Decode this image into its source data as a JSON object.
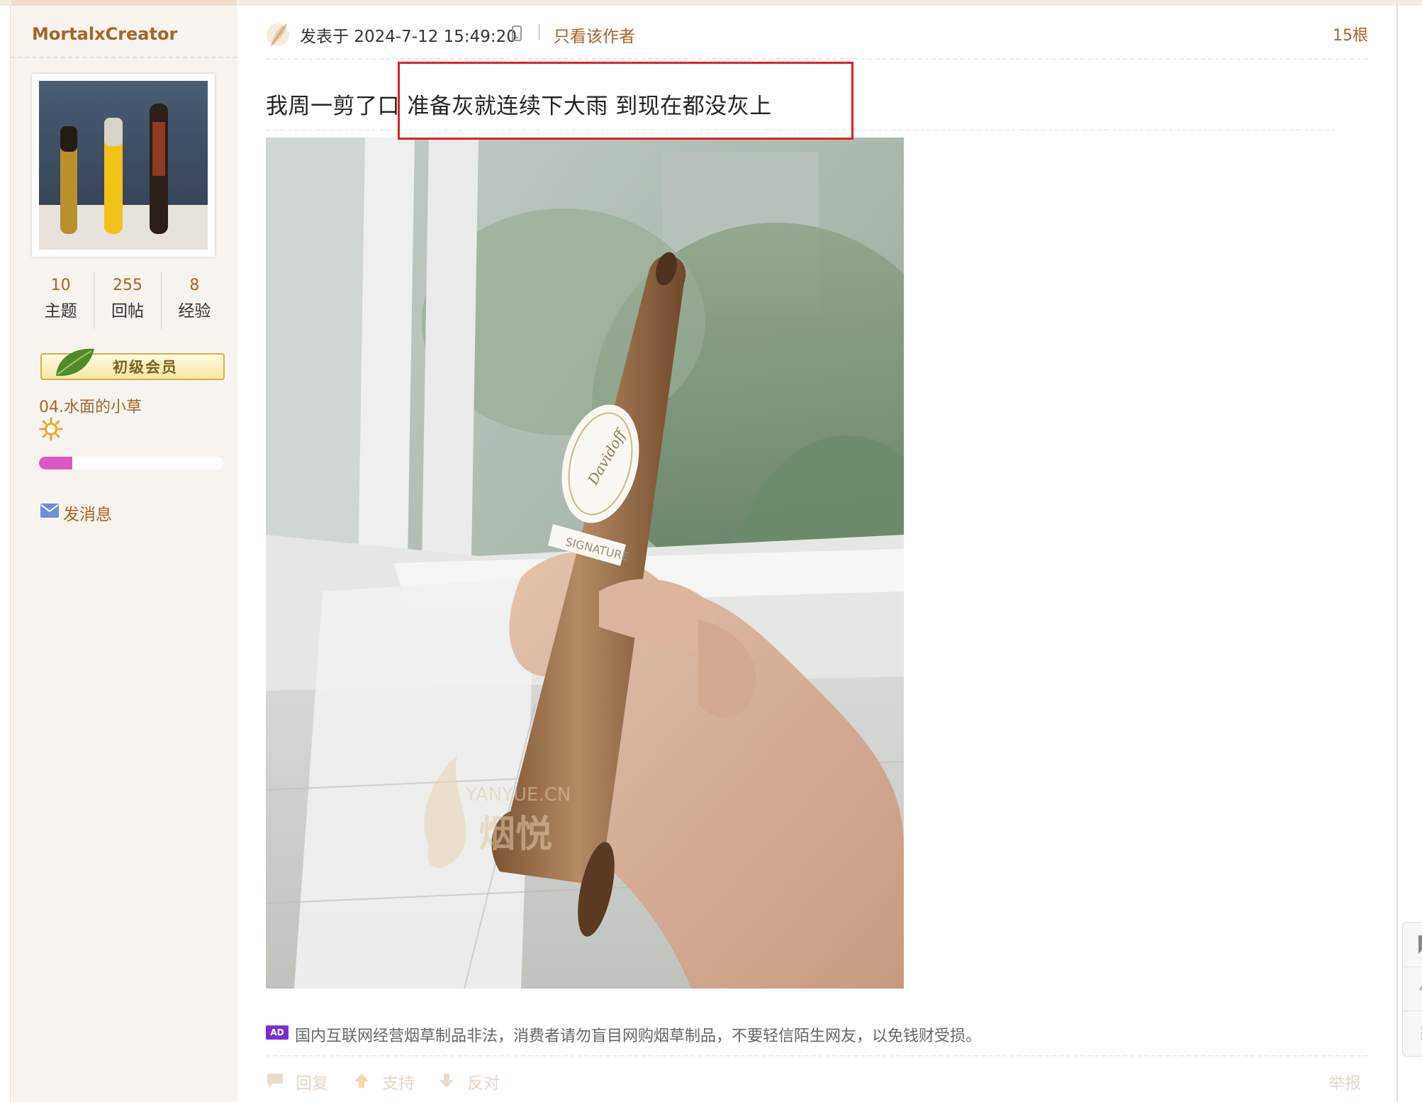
{
  "user": {
    "name": "MortalxCreator",
    "stats": [
      {
        "value": "10",
        "label": "主题"
      },
      {
        "value": "255",
        "label": "回帖"
      },
      {
        "value": "8",
        "label": "经验"
      }
    ],
    "rank": "初级会员",
    "group": "04.水面的小草",
    "level_progress": 0.18,
    "message_label": "发消息"
  },
  "post": {
    "time": "发表于 2024-7-12 15:49:20",
    "separator": "|",
    "only_author": "只看该作者",
    "floor": "15根",
    "text": "我周一剪了口 准备灰就连续下大雨 到现在都没灰上",
    "watermark_domain": "YANYUE.CN",
    "watermark_brand": "烟悦",
    "cigar_band_1": "Davidoff",
    "cigar_band_2": "SIGNATURE"
  },
  "ad": {
    "badge": "AD",
    "text": "国内互联网经营烟草制品非法，消费者请勿盲目网购烟草制品，不要轻信陌生网友，以免钱财受损。"
  },
  "actions": {
    "reply": "回复",
    "support": "支持",
    "oppose": "反对",
    "report": "举报"
  },
  "colors": {
    "accent": "#a4652a",
    "highlight": "#e02020",
    "level_bar": "#dc5ac3",
    "ad_badge": "#7b2fcf"
  },
  "icons": [
    "feather-icon",
    "phone-icon",
    "leaf-icon",
    "sun-icon",
    "mail-icon",
    "reply-icon",
    "support-icon",
    "oppose-icon"
  ]
}
